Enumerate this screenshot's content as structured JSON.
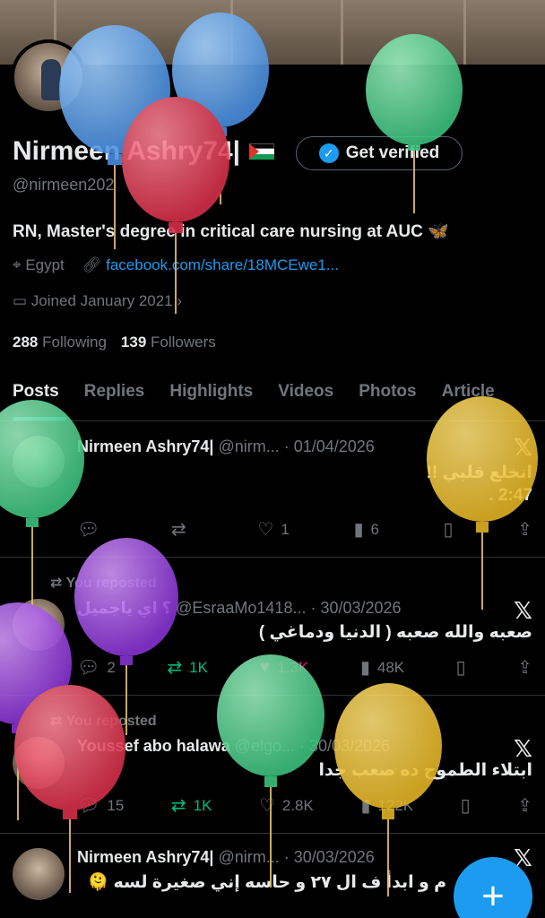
{
  "profile": {
    "name": "Nirmeen Ashry74|",
    "verify_label": "Get verified",
    "handle": "@nirmeen202",
    "bio": "RN, Master's degree in critical care nursing at AUC 🦋",
    "location": "Egypt",
    "link": "facebook.com/share/18MCEwe1...",
    "joined": "Joined January 2021",
    "following_count": "288",
    "following_label": "Following",
    "followers_count": "139",
    "followers_label": "Followers"
  },
  "tabs": [
    "Posts",
    "Replies",
    "Highlights",
    "Videos",
    "Photos",
    "Article"
  ],
  "posts": [
    {
      "author": "Nirmeen Ashry74|",
      "handle_date": "@nirm... · 01/04/2026",
      "text1": "انخلع قلبي !!",
      "text2": "2:47 .",
      "reply": "",
      "retweet": "",
      "like": "1",
      "views": "6"
    },
    {
      "reposted": "You reposted",
      "author": "؟ اي ياجميل",
      "handle_date": "@EsraaMo1418... · 30/03/2026",
      "text1": "صعبه والله صعبه ( الدنيا ودماغي )",
      "reply": "2",
      "retweet": "1K",
      "like": "1.3K",
      "views": "48K"
    },
    {
      "reposted": "You reposted",
      "author": "Youssef abo halawa",
      "handle_date": "@elgo... · 30/03/2026",
      "text1": "ابتلاء الطموح ده صعب جدا",
      "reply": "15",
      "retweet": "1K",
      "like": "2.8K",
      "views": "122K"
    },
    {
      "author": "Nirmeen Ashry74|",
      "handle_date": "@nirm... · 30/03/2026",
      "text1": "م و ابدأ ف ال ٢٧ و حاسه إني صغيرة لسه 🫠"
    }
  ],
  "icons": {
    "verified": "verified-check-icon",
    "location": "location-pin-icon",
    "link": "link-icon",
    "calendar": "calendar-icon",
    "x_logo": "x-logo-icon",
    "reply": "reply-icon",
    "retweet": "retweet-icon",
    "like": "heart-icon",
    "views": "views-icon",
    "bookmark": "bookmark-icon",
    "share": "share-icon",
    "compose": "compose-plus-icon"
  },
  "colors": {
    "accent": "#1d9bf0",
    "retweet": "#00ba7c",
    "like": "#f91880"
  }
}
